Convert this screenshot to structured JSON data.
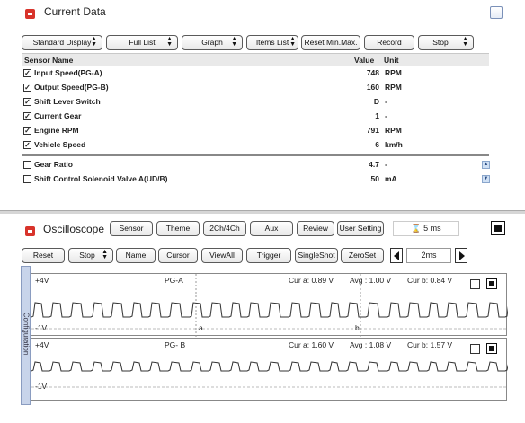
{
  "current": {
    "title": "Current Data",
    "toolbar": {
      "standard_display": "Standard Display",
      "full_list": "Full List",
      "graph": "Graph",
      "items_list": "Items List",
      "reset_minmax": "Reset Min.Max.",
      "record": "Record",
      "stop": "Stop"
    },
    "columns": {
      "name": "Sensor Name",
      "value": "Value",
      "unit": "Unit"
    },
    "rows": [
      {
        "checked": true,
        "name": "Input Speed(PG-A)",
        "value": "748",
        "unit": "RPM"
      },
      {
        "checked": true,
        "name": "Output Speed(PG-B)",
        "value": "160",
        "unit": "RPM"
      },
      {
        "checked": true,
        "name": "Shift Lever Switch",
        "value": "D",
        "unit": "-"
      },
      {
        "checked": true,
        "name": "Current Gear",
        "value": "1",
        "unit": "-"
      },
      {
        "checked": true,
        "name": "Engine RPM",
        "value": "791",
        "unit": "RPM"
      },
      {
        "checked": true,
        "name": "Vehicle Speed",
        "value": "6",
        "unit": "km/h"
      }
    ],
    "rows2": [
      {
        "checked": false,
        "name": "Gear Ratio",
        "value": "4.7",
        "unit": "-"
      },
      {
        "checked": false,
        "name": "Shift Control Solenoid Valve A(UD/B)",
        "value": "50",
        "unit": "mA"
      }
    ]
  },
  "scope": {
    "title": "Oscilloscope",
    "toolbar1": {
      "sensor": "Sensor",
      "theme": "Theme",
      "ch": "2Ch/4Ch",
      "aux": "Aux",
      "review": "Review",
      "user_setting": "User Setting",
      "time": "5 ms"
    },
    "toolbar2": {
      "reset": "Reset",
      "stop": "Stop",
      "name": "Name",
      "cursor": "Cursor",
      "viewall": "ViewAll",
      "trigger": "Trigger",
      "singleshot": "SingleShot",
      "zeroset": "ZeroSet",
      "time_div": "2ms"
    },
    "side_label": "Configuration",
    "channels": [
      {
        "top_label": "+4V",
        "bottom_label": "-1V",
        "name": "PG-A",
        "cur_a": "Cur a: 0.89 V",
        "avg": "Avg : 1.00 V",
        "cur_b": "Cur b: 0.84 V",
        "marker_a": "a",
        "marker_b": "b"
      },
      {
        "top_label": "+4V",
        "bottom_label": "-1V",
        "name": "PG- B",
        "cur_a": "Cur a: 1.60 V",
        "avg": "Avg : 1.08 V",
        "cur_b": "Cur b: 1.57 V"
      }
    ]
  }
}
